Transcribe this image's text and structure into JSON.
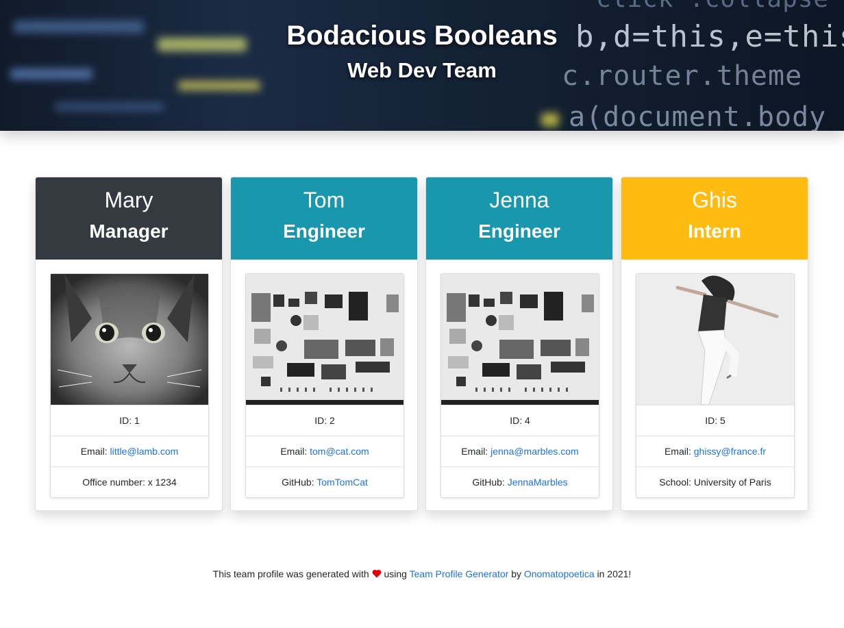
{
  "header": {
    "title": "Bodacious Booleans",
    "subtitle": "Web Dev Team",
    "code_background": [
      "b,d=this,e=this",
      "c.router.theme",
      "a(document.body",
      "click .collapse"
    ]
  },
  "cards": [
    {
      "name": "Mary",
      "role": "Manager",
      "color": "#343a40",
      "photo": "cat-photo",
      "id_label": "ID: 1",
      "email_label": "Email: ",
      "email": "little@lamb.com",
      "extra_label": "Office number: x 1234",
      "extra_link": ""
    },
    {
      "name": "Tom",
      "role": "Engineer",
      "color": "#1897ad",
      "photo": "parts-flatlay-photo",
      "id_label": "ID: 2",
      "email_label": "Email: ",
      "email": "tom@cat.com",
      "extra_label": "GitHub: ",
      "extra_link": "TomTomCat"
    },
    {
      "name": "Jenna",
      "role": "Engineer",
      "color": "#1897ad",
      "photo": "parts-flatlay-photo",
      "id_label": "ID: 4",
      "email_label": "Email: ",
      "email": "jenna@marbles.com",
      "extra_label": "GitHub: ",
      "extra_link": "JennaMarbles"
    },
    {
      "name": "Ghis",
      "role": "Intern",
      "color": "#ffbb0f",
      "photo": "jumping-woman-photo",
      "id_label": "ID: 5",
      "email_label": "Email: ",
      "email": "ghissy@france.fr",
      "extra_label": "School: University of Paris",
      "extra_link": ""
    }
  ],
  "footer": {
    "text_before": "This team profile was generated with",
    "text_using": "using",
    "generator_link": "Team Profile Generator",
    "text_by": "by",
    "author_link": "Onomatopoetica",
    "text_after": "in 2021!",
    "heart_color": "#e3000f"
  }
}
